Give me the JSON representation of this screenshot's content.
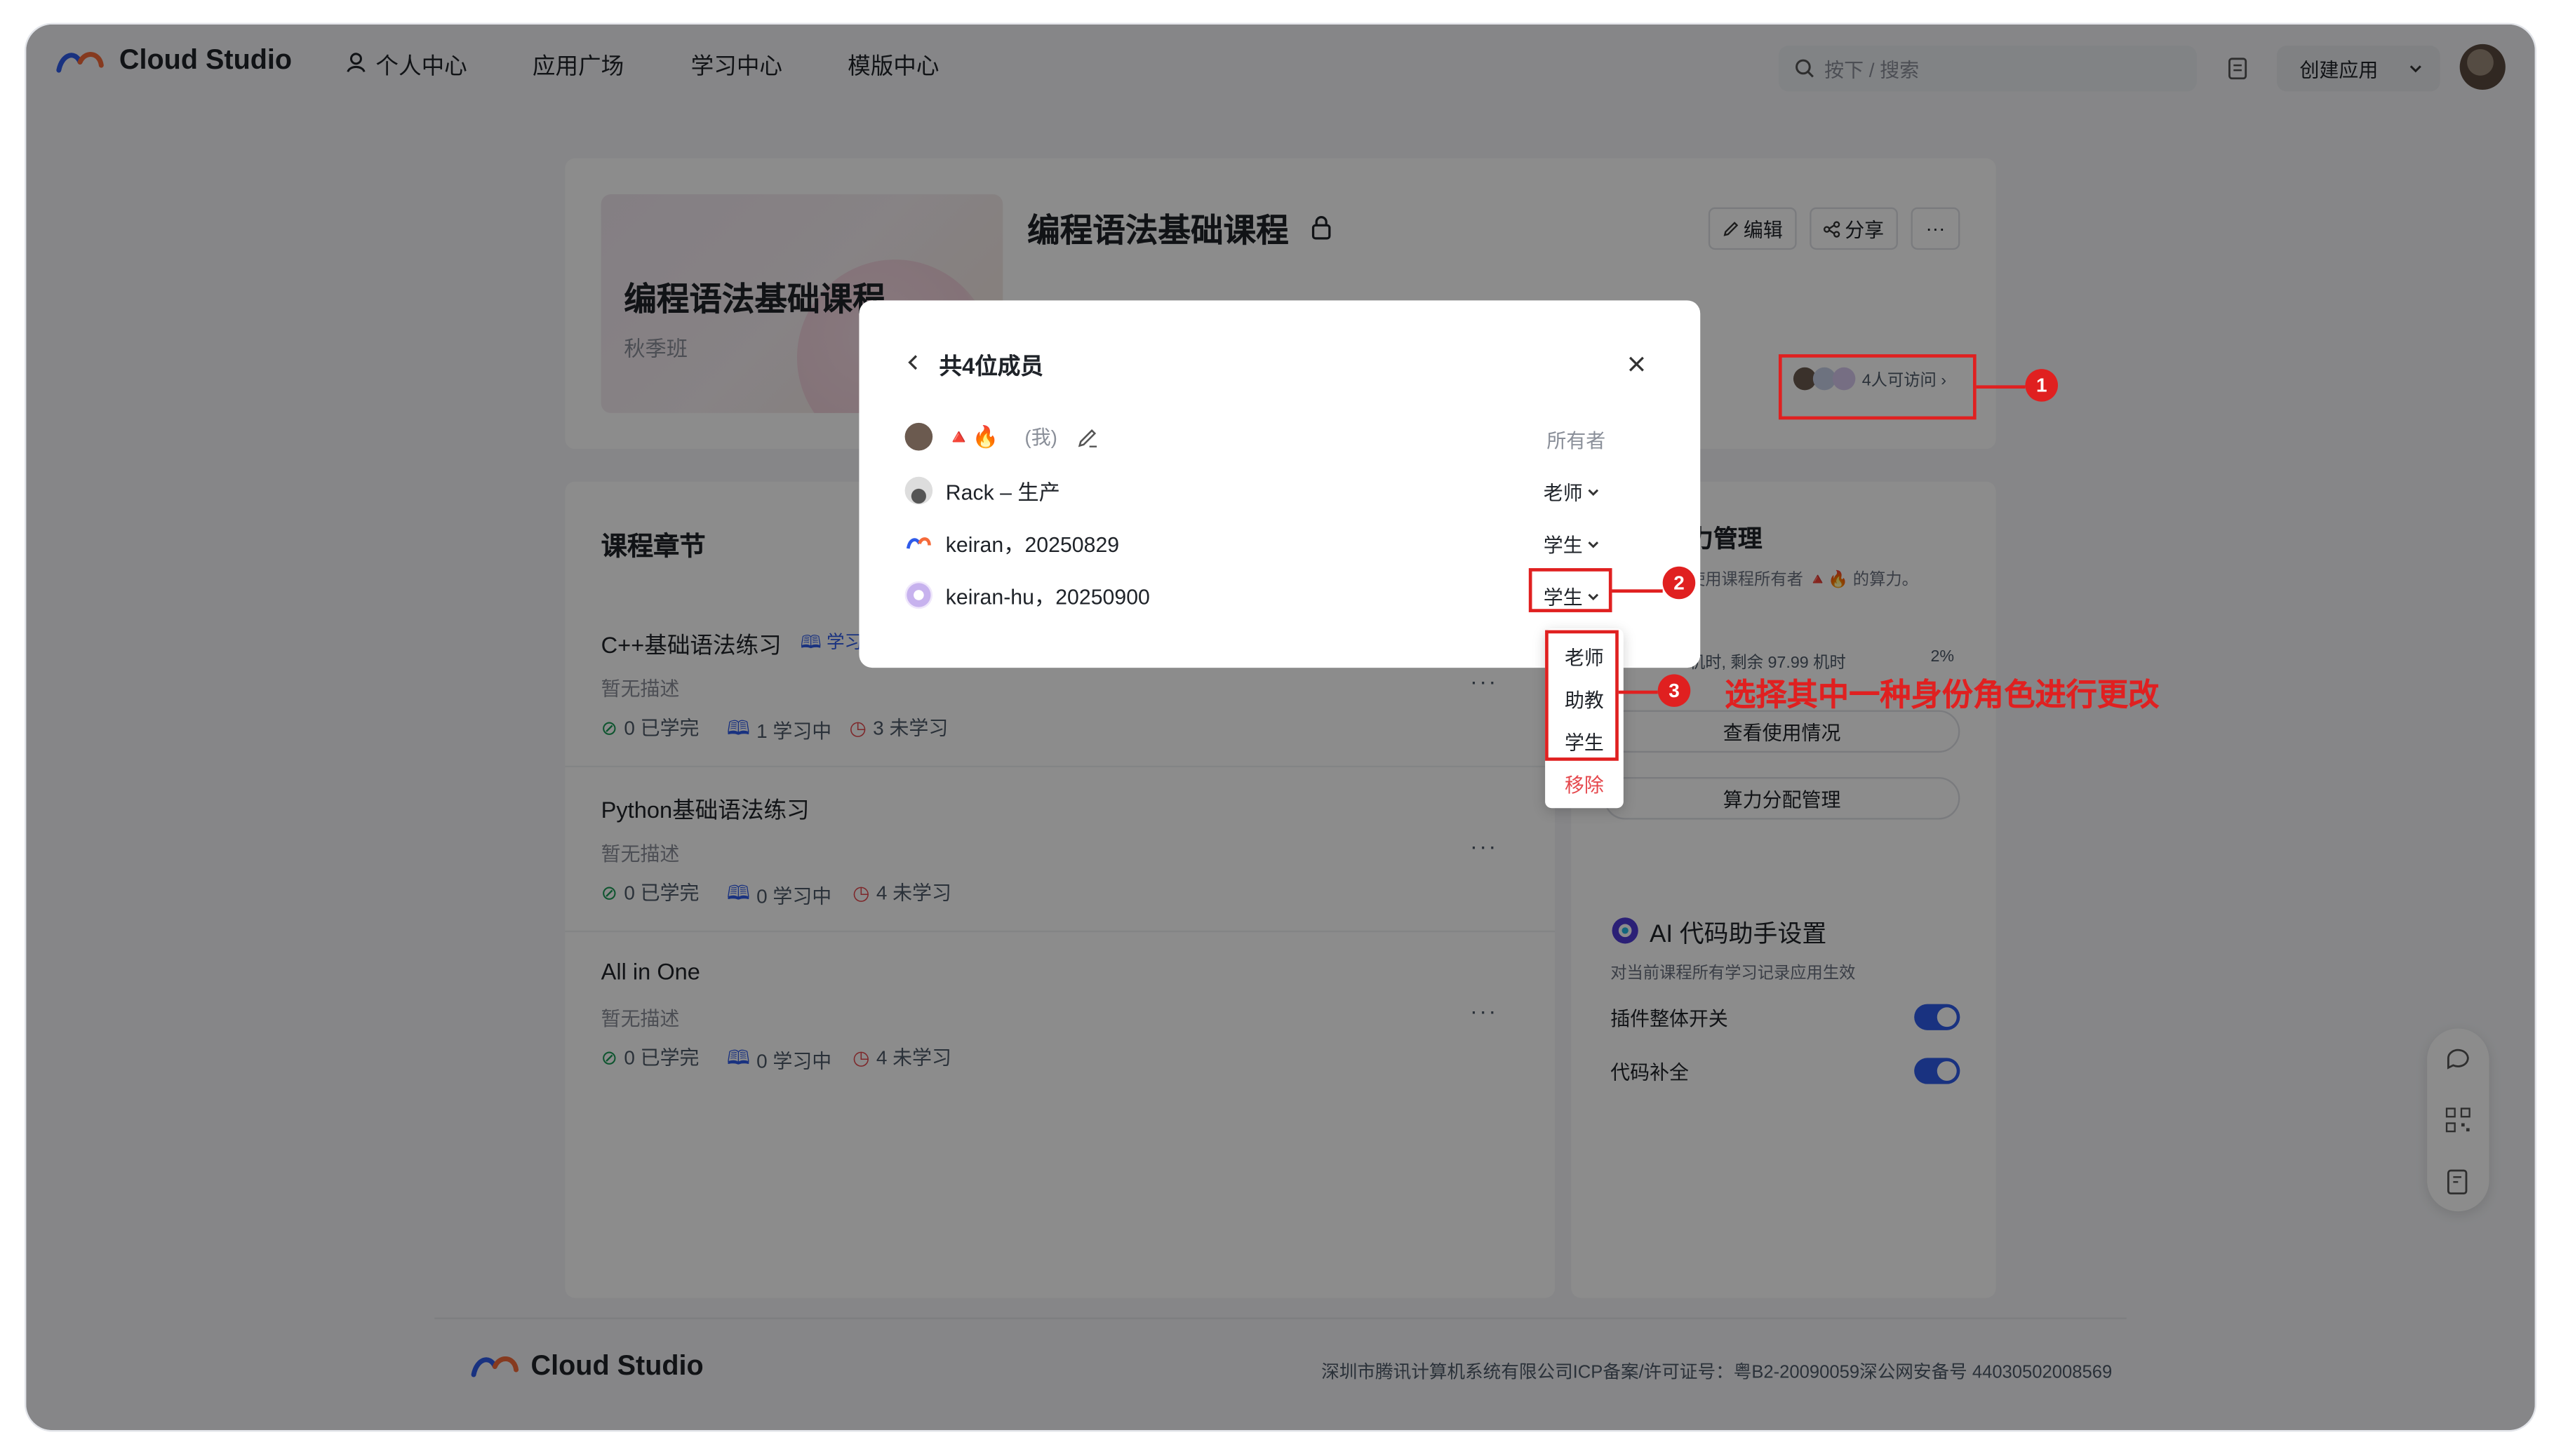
{
  "app": {
    "brand": "Cloud Studio",
    "nav_links": [
      "个人中心",
      "应用广场",
      "学习中心",
      "模版中心"
    ],
    "search_placeholder": "按下 /  搜索",
    "create_label": "创建应用"
  },
  "course": {
    "title": "编程语法基础课程",
    "cover_title": "编程语法基础课程",
    "cover_subtitle": "秋季班",
    "edit_label": "编辑",
    "share_label": "分享",
    "more_label": "···",
    "access_label": "4人可访问 ›"
  },
  "chapters": {
    "section_title": "课程章节",
    "items": [
      {
        "title": "C++基础语法练习",
        "tag": "学习",
        "desc": "暂无描述",
        "done": "0 已学完",
        "learning": "1 学习中",
        "todo": "3 未学习"
      },
      {
        "title": "Python基础语法练习",
        "desc": "暂无描述",
        "done": "0 已学完",
        "learning": "0 学习中",
        "todo": "4 未学习"
      },
      {
        "title": "All in One",
        "desc": "暂无描述",
        "done": "0 已学完",
        "learning": "0 学习中",
        "todo": "4 未学习"
      }
    ]
  },
  "compute": {
    "title_partial": "力管理",
    "desc_partial": "使用课程所有者 🔺🔥 的算力。",
    "usage_partial": "机时, 剩余 97.99 机时",
    "usage_pct": "2%",
    "view_usage": "查看使用情况",
    "allocate": "算力分配管理"
  },
  "ai": {
    "title": "AI 代码助手设置",
    "desc": "对当前课程所有学习记录应用生效",
    "plugin_switch": "插件整体开关",
    "completion": "代码补全",
    "plugin_on": true,
    "completion_on": true
  },
  "footer": {
    "brand": "Cloud Studio",
    "icp": "深圳市腾讯计算机系统有限公司ICP备案/许可证号：粤B2-20090059深公网安备号 44030502008569"
  },
  "modal": {
    "title": "共4位成员",
    "members": [
      {
        "name": "🔺🔥",
        "suffix": "(我)",
        "role": "所有者"
      },
      {
        "name": "Rack – 生产",
        "role": "老师"
      },
      {
        "name": "keiran，20250829",
        "role": "学生"
      },
      {
        "name": "keiran-hu，20250900",
        "role": "学生"
      }
    ]
  },
  "role_menu": {
    "options": [
      "老师",
      "助教",
      "学生"
    ],
    "remove": "移除"
  },
  "annotations": {
    "step1": "1",
    "step2": "2",
    "step3": "3",
    "instruction": "选择其中一种身份角色进行更改"
  },
  "colors": {
    "accent": "#2f5bea",
    "annotation_red": "#e02020",
    "remove_red": "#e5484d"
  }
}
